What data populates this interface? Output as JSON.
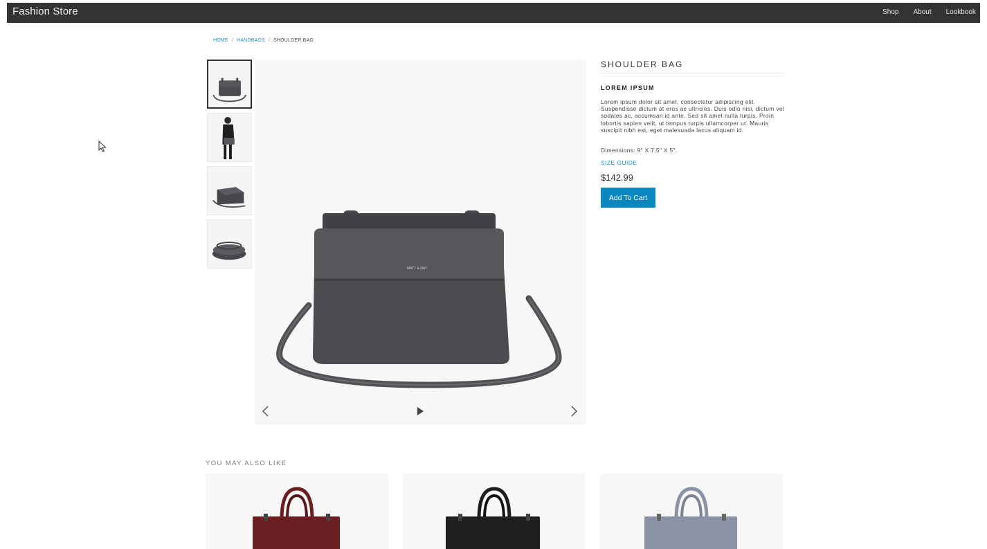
{
  "header": {
    "brand": "Fashion Store",
    "nav": [
      "Shop",
      "About",
      "Lookbook"
    ]
  },
  "breadcrumb": {
    "home": "HOME",
    "category": "HANDBAGS",
    "current": "SHOULDER BAG",
    "separator": "/"
  },
  "gallery": {
    "thumbnails": [
      {
        "icon": "bag-front-thumbnail",
        "active": true
      },
      {
        "icon": "model-wearing-bag-thumbnail",
        "active": false
      },
      {
        "icon": "bag-angle-thumbnail",
        "active": false
      },
      {
        "icon": "bag-top-thumbnail",
        "active": false
      }
    ],
    "brand_stamp": "MATT & NAT",
    "controls": [
      "chevron-left-icon",
      "play-icon",
      "chevron-right-icon"
    ]
  },
  "product": {
    "title": "SHOULDER BAG",
    "subtitle": "LOREM IPSUM",
    "description": "Lorem ipsum dolor sit amet, consectetur adipiscing elit. Suspendisse dictum at eros ac ultricies. Duis odio nisi, dictum vel sodales ac, accumsan id ante. Sed sit amet nulla turpis. Proin lobortis sapien velit, ut tempus turpis ullamcorper ut. Mauris suscipit nibh est, eget malesuada lacus aliquam id.",
    "dimensions": "Dimensions: 9\" X 7.5\" X 5\".",
    "size_guide": "SIZE GUIDE",
    "price": "$142.99",
    "add_to_cart": "Add To Cart"
  },
  "related": {
    "heading": "YOU MAY ALSO LIKE",
    "items": [
      {
        "color": "#6b1f22"
      },
      {
        "color": "#1e1e1e"
      },
      {
        "color": "#8a93a6"
      }
    ]
  },
  "colors": {
    "topbar": "#333333",
    "accent": "#0a87bf",
    "link": "#1a8fb8",
    "bag": "#4a4c50"
  }
}
